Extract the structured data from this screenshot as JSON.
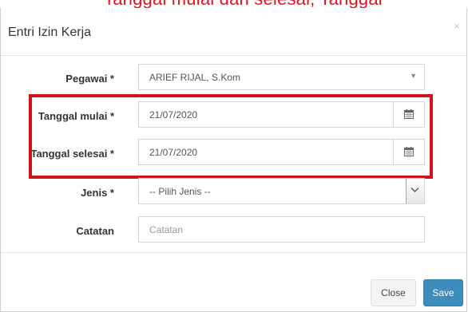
{
  "banner": {
    "text": "Tanggal mulai dan selesai, Tanggal"
  },
  "dialog": {
    "title": "Entri Izin Kerja",
    "close_icon": "×"
  },
  "form": {
    "pegawai": {
      "label": "Pegawai *",
      "value": "ARIEF RIJAL, S.Kom"
    },
    "tanggal_mulai": {
      "label": "Tanggal mulai *",
      "value": "21/07/2020"
    },
    "tanggal_selesai": {
      "label": "Tanggal selesai *",
      "value": "21/07/2020"
    },
    "jenis": {
      "label": "Jenis *",
      "value": "-- Pilih Jenis --"
    },
    "catatan": {
      "label": "Catatan",
      "placeholder": "Catatan"
    }
  },
  "footer": {
    "close_label": "Close",
    "save_label": "Save"
  },
  "colors": {
    "highlight": "#d0121b",
    "primary": "#3c8dbc",
    "banner_text": "#e0141e"
  },
  "icons": {
    "calendar": "calendar-icon",
    "select_arrow": "caret-down-icon",
    "chevron": "chevron-down-icon"
  }
}
